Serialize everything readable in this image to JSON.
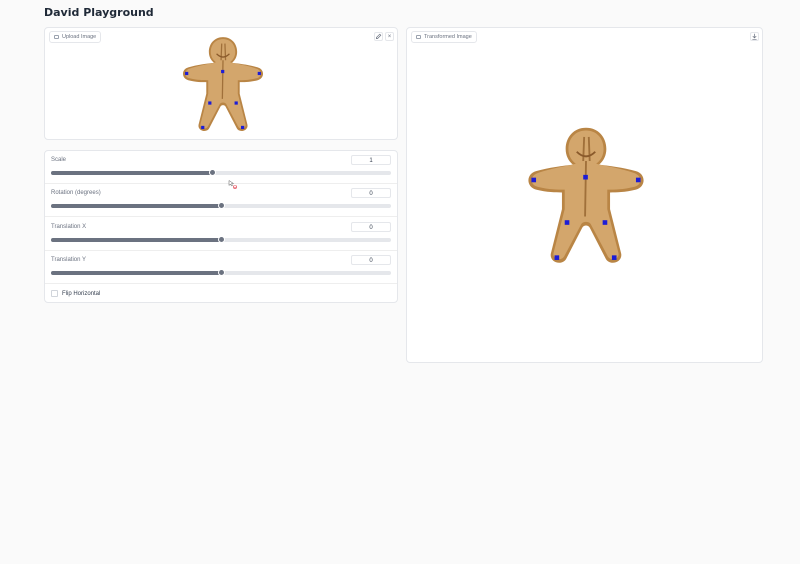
{
  "app": {
    "title": "David Playground"
  },
  "upload_panel": {
    "label": "Upload Image",
    "edit_icon": "pencil-icon",
    "clear_label": "×"
  },
  "output_panel": {
    "label": "Transformed Image",
    "download_icon": "download-icon"
  },
  "controls": {
    "scale": {
      "label": "Scale",
      "value": "1",
      "fraction": 0.475
    },
    "rotation": {
      "label": "Rotation (degrees)",
      "value": "0",
      "fraction": 0.5
    },
    "translation_x": {
      "label": "Translation X",
      "value": "0",
      "fraction": 0.5
    },
    "translation_y": {
      "label": "Translation Y",
      "value": "0",
      "fraction": 0.5
    }
  },
  "flip": {
    "label": "Flip Horizontal",
    "checked": false
  },
  "colors": {
    "slider_fill": "#6b7280",
    "marker": "#1d1dd6",
    "cookie": "#c8965a"
  }
}
